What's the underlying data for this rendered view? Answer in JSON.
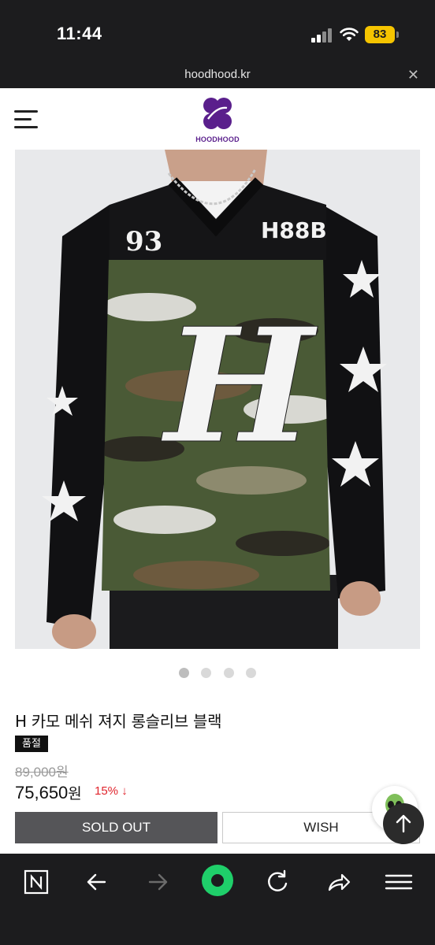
{
  "status_bar": {
    "time": "11:44",
    "battery": "83"
  },
  "browser": {
    "url": "hoodhood.kr",
    "close_icon": "close-icon"
  },
  "header": {
    "logo_text": "HOODHOOD",
    "menu_icon": "hamburger-menu-icon"
  },
  "gallery": {
    "slide_count": 4,
    "active_index": 0
  },
  "product": {
    "title": "H 카모 메쉬 져지 롱슬리브 블랙",
    "badge": "품절",
    "original_price": "89,000원",
    "sale_price": "75,650",
    "sale_currency": "원",
    "discount": "15% ↓"
  },
  "actions": {
    "soldout_label": "SOLD OUT",
    "wish_label": "WISH"
  },
  "floating": {
    "top_icon": "arrow-up-icon",
    "mascot_icon": "alien-icon"
  },
  "colors": {
    "brand": "#5a1f8c",
    "discount": "#e0242c",
    "soldout_button": "#555558",
    "chrome": "#1c1c1e",
    "browser_home": "#1fcf6a"
  }
}
